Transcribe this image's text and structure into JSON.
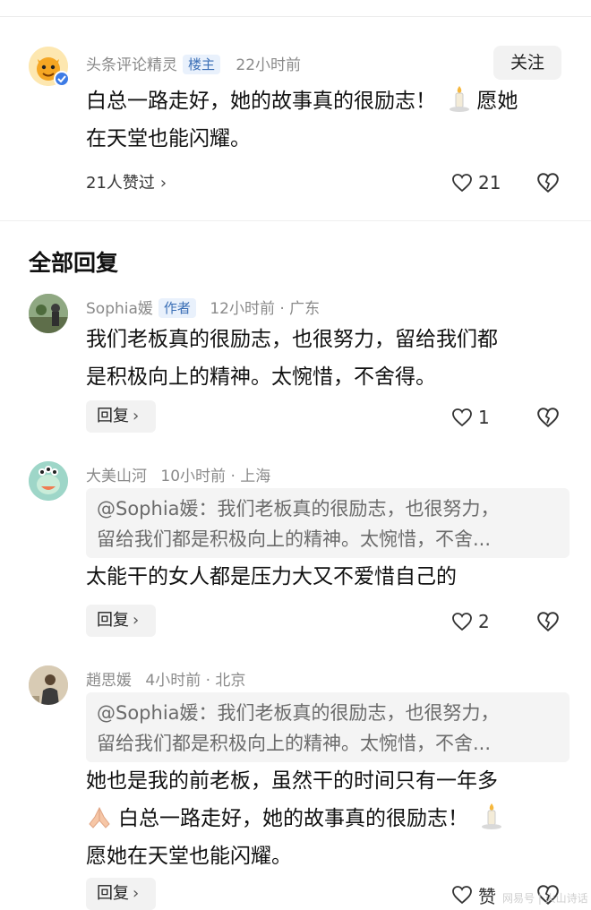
{
  "main_comment": {
    "author": "头条评论精灵",
    "badge": "楼主",
    "time": "22小时前",
    "follow_label": "关注",
    "text_line1": "白总一路走好，她的故事真的很励志！",
    "text_line1b": "愿她",
    "text_line2": "在天堂也能闪耀。",
    "likers": "21人赞过",
    "like_count": "21"
  },
  "section_title": "全部回复",
  "replies": [
    {
      "author": "Sophia媛",
      "badge": "作者",
      "meta": "12小时前 · 广东",
      "text_line1": "我们老板真的很励志，也很努力，留给我们都",
      "text_line2": "是积极向上的精神。太惋惜，不舍得。",
      "reply_label": "回复",
      "like_count": "1"
    },
    {
      "author": "大美山河",
      "meta": "10小时前 · 上海",
      "quote_line1": "@Sophia媛：我们老板真的很励志，也很努力，",
      "quote_line2": "留给我们都是积极向上的精神。太惋惜，不舍...",
      "text_line1": "太能干的女人都是压力大又不爱惜自己的",
      "reply_label": "回复",
      "like_count": "2"
    },
    {
      "author": "趙思媛",
      "meta": "4小时前 · 北京",
      "quote_line1": "@Sophia媛：我们老板真的很励志，也很努力，",
      "quote_line2": "留给我们都是积极向上的精神。太惋惜，不舍...",
      "text_line1": "她也是我的前老板，虽然干的时间只有一年多",
      "text_line2": "白总一路走好，她的故事真的很励志！",
      "text_line3": "愿她在天堂也能闪耀。",
      "reply_label": "回复",
      "like_count": "赞"
    }
  ],
  "watermark": "网易号 | 火山诗话",
  "icons": [
    "heart-icon",
    "heart-broken-icon",
    "candle-emoji",
    "pray-emoji",
    "verified-icon",
    "chevron-right-icon"
  ],
  "colors": {
    "badge_bg": "#e9f1fc",
    "badge_text": "#3b6fb6",
    "meta": "#8a8a8a"
  }
}
